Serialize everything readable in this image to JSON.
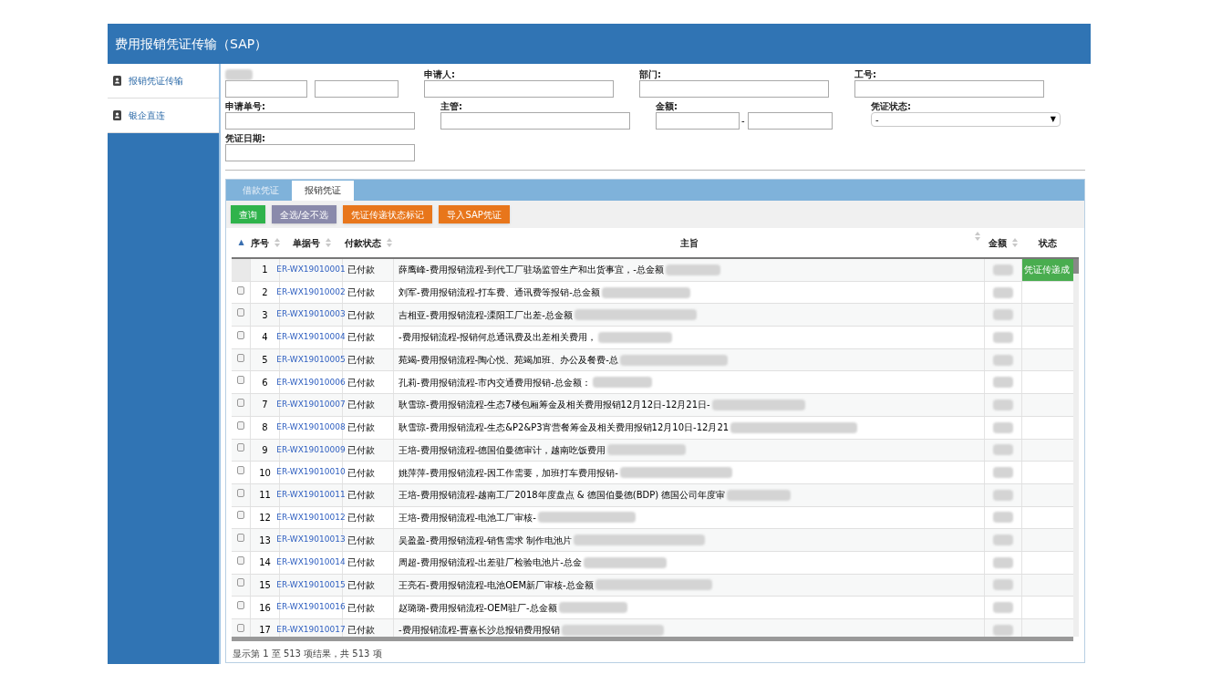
{
  "header": {
    "title": "费用报销凭证传输（SAP）"
  },
  "sidebar": {
    "items": [
      {
        "label": "报销凭证传输"
      },
      {
        "label": "银企直连"
      }
    ]
  },
  "filters": {
    "row_1": [
      {
        "kind": "daterange"
      },
      {
        "kind": "text",
        "label": "申请人:"
      },
      {
        "kind": "text",
        "label": "部门:"
      },
      {
        "kind": "text",
        "label": "工号:"
      }
    ],
    "row_2": [
      {
        "kind": "text",
        "label": "申请单号:"
      },
      {
        "kind": "text",
        "label": "主管:"
      },
      {
        "kind": "range",
        "label": "金额:",
        "separator": "-"
      },
      {
        "kind": "select",
        "label": "凭证状态:",
        "value": "-",
        "arrow": "▼"
      }
    ],
    "row_3": [
      {
        "kind": "disabled",
        "label": "凭证日期:"
      }
    ]
  },
  "tabs": [
    {
      "label": "借款凭证",
      "selected": false
    },
    {
      "label": "报销凭证",
      "selected": true
    }
  ],
  "buttons": [
    {
      "label": "查询",
      "color": "#2fb34b"
    },
    {
      "label": "全选/全不选",
      "color": "#8a8aab"
    },
    {
      "label": "凭证传递状态标记",
      "color": "#e8761b"
    },
    {
      "label": "导入SAP凭证",
      "color": "#e8761b"
    }
  ],
  "table": {
    "columns": [
      {
        "sort_mark": "▲"
      },
      {
        "label": "序号",
        "sortable": true
      },
      {
        "label": "单据号",
        "sortable": true
      },
      {
        "label": "付款状态",
        "sortable": true
      },
      {
        "label": "主旨",
        "sortable": true
      },
      {
        "label": "金额",
        "sortable": true
      },
      {
        "label": "状态",
        "sortable": false
      }
    ],
    "rows": [
      {
        "checkbox": false,
        "no": "1",
        "id": "ER-WX19010001",
        "payment": "已付款",
        "subject": "薛鹰峰-费用报销流程-到代工厂驻场监管生产和出货事宜，-总金额",
        "status": "凭证传递成"
      },
      {
        "checkbox": true,
        "no": "2",
        "id": "ER-WX19010002",
        "payment": "已付款",
        "subject": "刘军-费用报销流程-打车费、通讯费等报销-总金额"
      },
      {
        "checkbox": true,
        "no": "3",
        "id": "ER-WX19010003",
        "payment": "已付款",
        "subject": "吉相亚-费用报销流程-溧阳工厂出差-总金额"
      },
      {
        "checkbox": true,
        "no": "4",
        "id": "ER-WX19010004",
        "payment": "已付款",
        "subject": "-费用报销流程-报销何总通讯费及出差相关费用，"
      },
      {
        "checkbox": true,
        "no": "5",
        "id": "ER-WX19010005",
        "payment": "已付款",
        "subject": "苑竭-费用报销流程-陶心悦、苑竭加班、办公及餐费-总"
      },
      {
        "checkbox": true,
        "no": "6",
        "id": "ER-WX19010006",
        "payment": "已付款",
        "subject": "孔莉-费用报销流程-市内交通费用报销-总金额："
      },
      {
        "checkbox": true,
        "no": "7",
        "id": "ER-WX19010007",
        "payment": "已付款",
        "subject": "耿雪琼-费用报销流程-生态7楼包厢筹金及相关费用报销12月12日-12月21日-"
      },
      {
        "checkbox": true,
        "no": "8",
        "id": "ER-WX19010008",
        "payment": "已付款",
        "subject": "耿雪琼-费用报销流程-生态&P2&P3宵营餐筹金及相关费用报销12月10日-12月21"
      },
      {
        "checkbox": true,
        "no": "9",
        "id": "ER-WX19010009",
        "payment": "已付款",
        "subject": "王培-费用报销流程-德国伯曼德审计，越南吃饭费用"
      },
      {
        "checkbox": true,
        "no": "10",
        "id": "ER-WX19010010",
        "payment": "已付款",
        "subject": "姚萍萍-费用报销流程-因工作需要，加班打车费用报销-"
      },
      {
        "checkbox": true,
        "no": "11",
        "id": "ER-WX19010011",
        "payment": "已付款",
        "subject": "王培-费用报销流程-越南工厂2018年度盘点 & 德国伯曼德(BDP) 德国公司年度审"
      },
      {
        "checkbox": true,
        "no": "12",
        "id": "ER-WX19010012",
        "payment": "已付款",
        "subject": "王培-费用报销流程-电池工厂审核-"
      },
      {
        "checkbox": true,
        "no": "13",
        "id": "ER-WX19010013",
        "payment": "已付款",
        "subject": "吴盈盈-费用报销流程-销售需求 制作电池片"
      },
      {
        "checkbox": true,
        "no": "14",
        "id": "ER-WX19010014",
        "payment": "已付款",
        "subject": "周超-费用报销流程-出差驻厂检验电池片-总金"
      },
      {
        "checkbox": true,
        "no": "15",
        "id": "ER-WX19010015",
        "payment": "已付款",
        "subject": "王亮石-费用报销流程-电池OEM新厂审核-总金额"
      },
      {
        "checkbox": true,
        "no": "16",
        "id": "ER-WX19010016",
        "payment": "已付款",
        "subject": "赵璐璐-费用报销流程-OEM驻厂-总金额"
      },
      {
        "checkbox": true,
        "no": "17",
        "id": "ER-WX19010017",
        "payment": "已付款",
        "subject": "-费用报销流程-曹嘉长沙总报销费用报销"
      }
    ]
  },
  "footer": "显示第 1 至 513 项结果，共 513 项"
}
